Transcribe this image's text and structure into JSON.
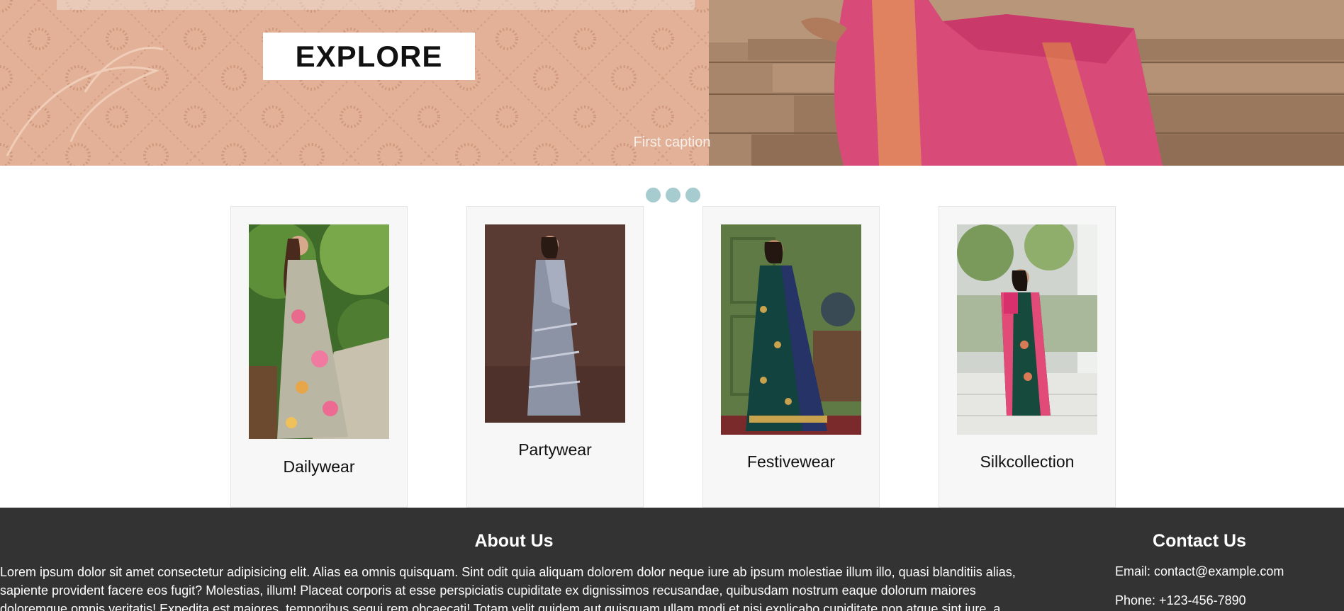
{
  "hero": {
    "button_label": "EXPLORE",
    "caption": "First caption",
    "indicator_count": 3
  },
  "categories": [
    {
      "label": "Dailywear"
    },
    {
      "label": "Partywear"
    },
    {
      "label": "Festivewear"
    },
    {
      "label": "Silkcollection"
    }
  ],
  "footer": {
    "about_title": "About Us",
    "about_text": "Lorem ipsum dolor sit amet consectetur adipisicing elit. Alias ea omnis quisquam. Sint odit quia aliquam dolorem dolor neque iure ab ipsum molestiae illum illo, quasi blanditiis alias, sapiente provident facere eos fugit? Molestias, illum! Placeat corporis at esse perspiciatis cupiditate ex dignissimos recusandae, quibusdam nostrum eaque dolorum maiores doloremque omnis veritatis! Expedita est maiores, temporibus sequi rem obcaecati! Totam velit quidem aut quisquam ullam modi et nisi explicabo cupiditate non atque sint iure, a",
    "contact_title": "Contact Us",
    "email": "Email: contact@example.com",
    "phone": "Phone: +123-456-7890"
  },
  "colors": {
    "hero_background": "#e2b197",
    "indicator": "#a7cccf",
    "card_background": "#f7f7f7",
    "footer_background": "#333333"
  }
}
